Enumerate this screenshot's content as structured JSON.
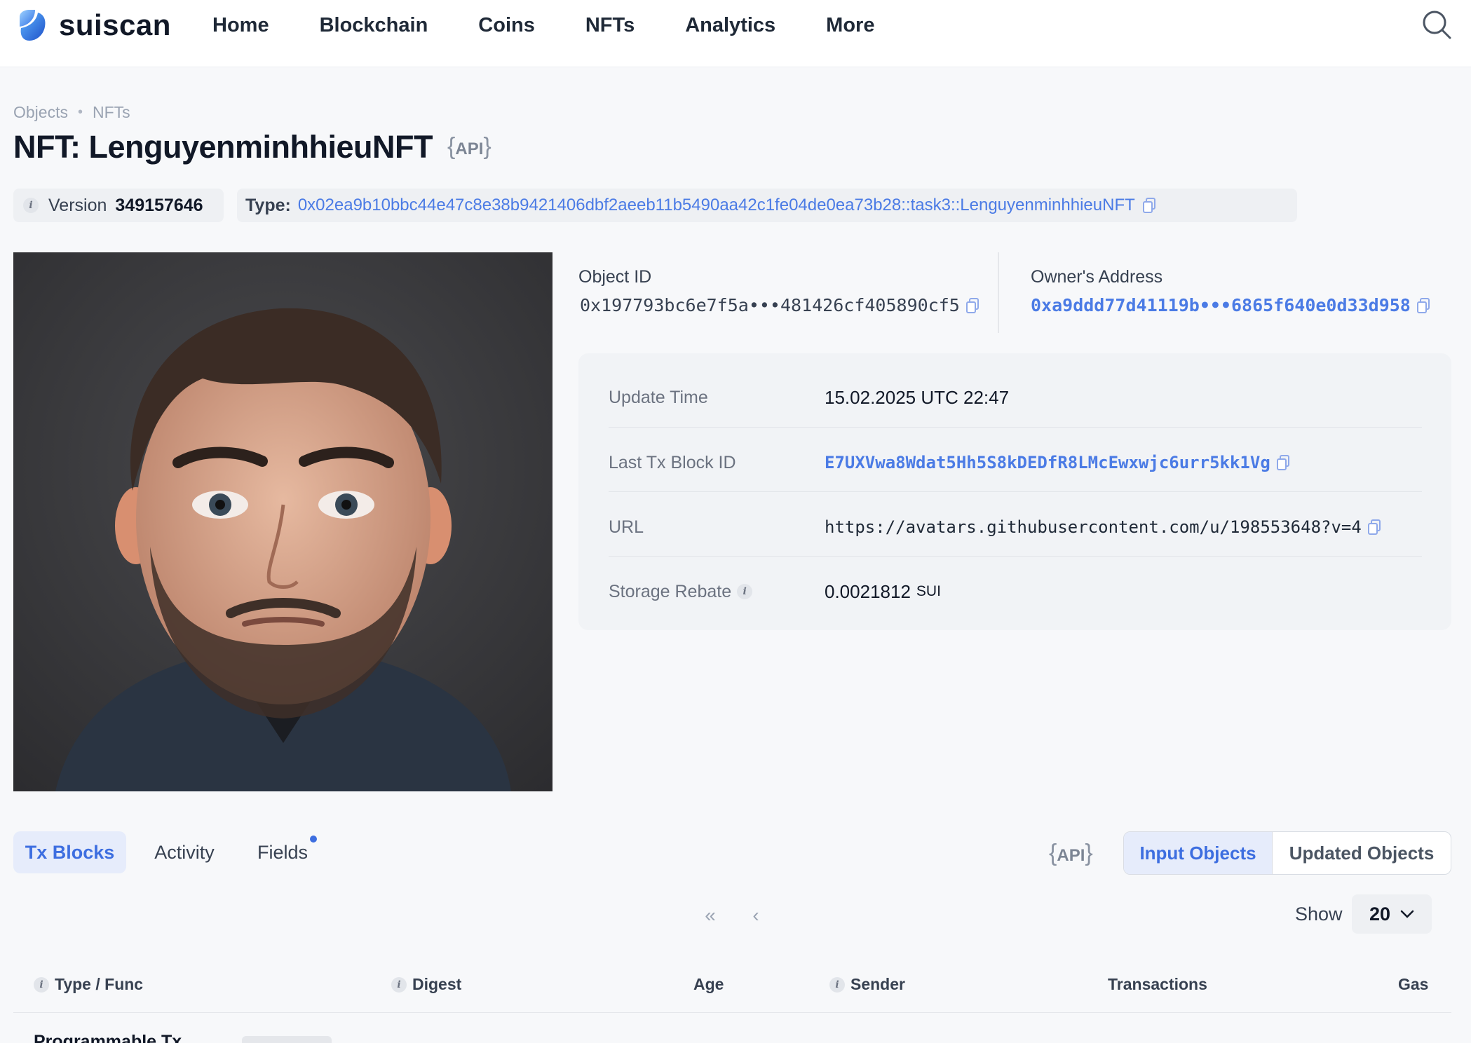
{
  "header": {
    "logo_text": "suiscan",
    "nav": [
      "Home",
      "Blockchain",
      "Coins",
      "NFTs",
      "Analytics",
      "More"
    ]
  },
  "breadcrumb": [
    "Objects",
    "NFTs"
  ],
  "page": {
    "title": "NFT: LenguyenminhhieuNFT",
    "api_label": "API"
  },
  "chips": {
    "version_label": "Version",
    "version_value": "349157646",
    "type_label": "Type:",
    "type_value": "0x02ea9b10bbc44e47c8e38b9421406dbf2aeeb11b5490aa42c1fe04de0ea73b28::task3::LenguyenminhhieuNFT"
  },
  "object": {
    "id_label": "Object ID",
    "id_value": "0x197793bc6e7f5a•••481426cf405890cf5",
    "owner_label": "Owner's Address",
    "owner_value": "0xa9ddd77d41119b•••6865f640e0d33d958"
  },
  "details": {
    "update_time_label": "Update Time",
    "update_time_value": "15.02.2025 UTC 22:47",
    "last_tx_label": "Last Tx Block ID",
    "last_tx_value": "E7UXVwa8Wdat5Hh5S8kDEDfR8LMcEwxwjc6urr5kk1Vg",
    "url_label": "URL",
    "url_value": "https://avatars.githubusercontent.com/u/198553648?v=4",
    "storage_label": "Storage Rebate",
    "storage_value": "0.0021812",
    "storage_unit": "SUI"
  },
  "tabs": [
    "Tx Blocks",
    "Activity",
    "Fields"
  ],
  "api_label": "API",
  "segment": [
    "Input Objects",
    "Updated Objects"
  ],
  "pagination": {
    "first": "«",
    "prev": "‹",
    "show_label": "Show",
    "show_value": "20"
  },
  "table": {
    "headers": [
      "Type / Func",
      "Digest",
      "Age",
      "Sender",
      "Transactions",
      "Gas"
    ],
    "rows": [
      {
        "type": "Programmable Tx"
      }
    ]
  },
  "colors": {
    "accent": "#3d6ee0",
    "link": "#4b7be5",
    "background": "#f7f8fa"
  },
  "icons": [
    "suiscan-logo-icon",
    "search-icon",
    "info-icon",
    "copy-icon",
    "chevron-down-icon",
    "double-chevron-left-icon",
    "chevron-left-icon"
  ]
}
